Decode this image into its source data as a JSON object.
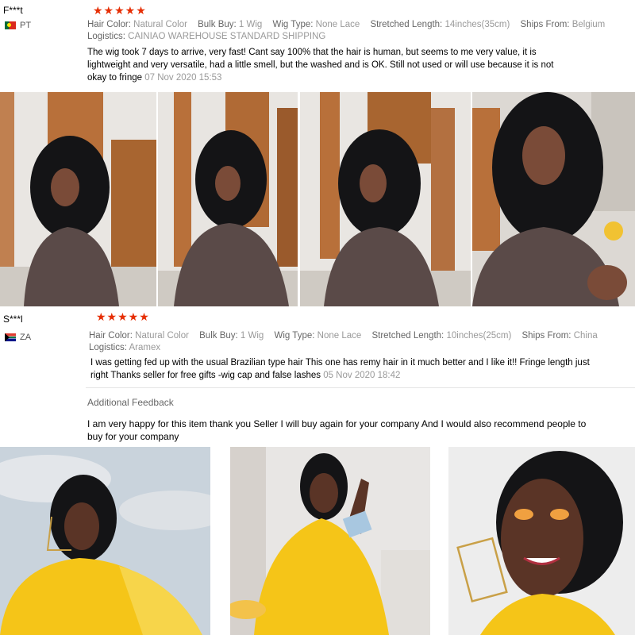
{
  "reviews": [
    {
      "user": "F***t",
      "stars": "★★★★★",
      "country": "PT",
      "attrs": {
        "hair_color_label": "Hair Color:",
        "hair_color": "Natural Color",
        "bulk_buy_label": "Bulk Buy:",
        "bulk_buy": "1 Wig",
        "wig_type_label": "Wig Type:",
        "wig_type": "None Lace",
        "length_label": "Stretched Length:",
        "length": "14inches(35cm)",
        "ships_label": "Ships From:",
        "ships": "Belgium",
        "logistics_label": "Logistics:",
        "logistics": "CAINIAO WAREHOUSE STANDARD SHIPPING"
      },
      "text": "The wig took 7 days to arrive, very fast! Cant say 100% that the hair is human, but seems to me very value, it is lightweight and very versatile, had a little smell, but the washed and is OK. Still not used or will use because it is not okay to fringe",
      "date": "07 Nov 2020 15:53"
    },
    {
      "user": "S***l",
      "stars": "★★★★★",
      "country": "ZA",
      "attrs": {
        "hair_color_label": "Hair Color:",
        "hair_color": "Natural Color",
        "bulk_buy_label": "Bulk Buy:",
        "bulk_buy": "1 Wig",
        "wig_type_label": "Wig Type:",
        "wig_type": "None Lace",
        "length_label": "Stretched Length:",
        "length": "10inches(25cm)",
        "ships_label": "Ships From:",
        "ships": "China",
        "logistics_label": "Logistics:",
        "logistics": "Aramex"
      },
      "text": "I was getting fed up with the usual Brazilian type hair This one has remy hair in it much better and I like it!! Fringe length just right Thanks seller for free gifts -wig cap and false lashes",
      "date": "05 Nov 2020 18:42",
      "additional_label": "Additional Feedback",
      "additional_text": "I am very happy for this item thank you Seller I will buy again for your company And I would also recommend people to buy for your company"
    }
  ],
  "colors": {
    "star": "#e62e04",
    "muted": "#999999",
    "text": "#000000",
    "sweater": "#5a4a48",
    "yellow_top": "#f5c518"
  }
}
